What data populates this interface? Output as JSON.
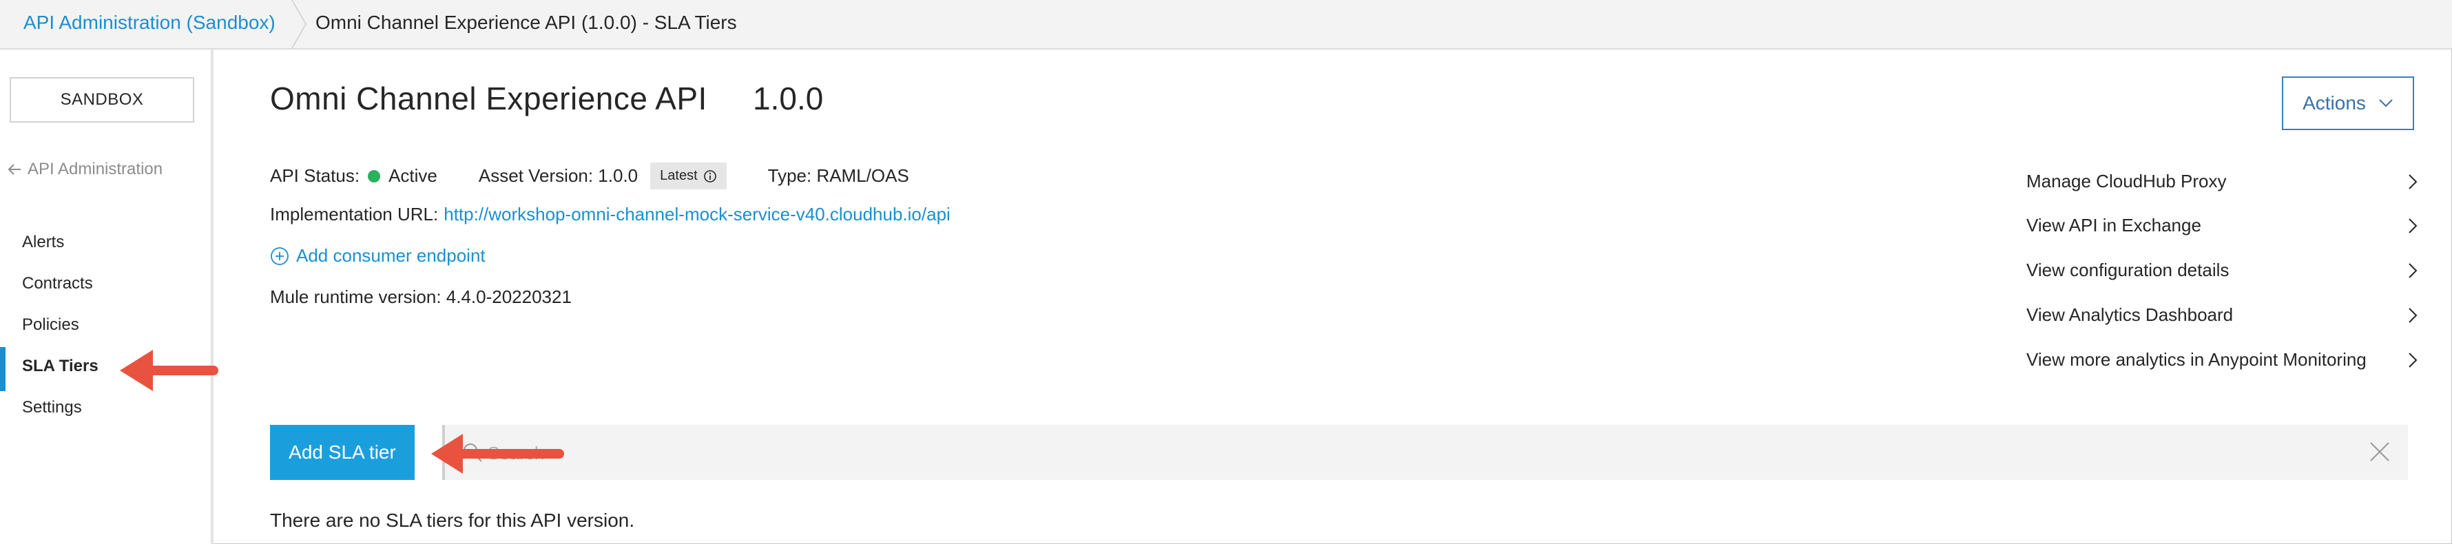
{
  "breadcrumb": {
    "parent": "API Administration (Sandbox)",
    "current": "Omni Channel Experience API (1.0.0) - SLA Tiers"
  },
  "sidebar": {
    "environment": "SANDBOX",
    "back_label": "API Administration",
    "items": [
      {
        "label": "Alerts"
      },
      {
        "label": "Contracts"
      },
      {
        "label": "Policies"
      },
      {
        "label": "SLA Tiers",
        "active": true
      },
      {
        "label": "Settings"
      }
    ]
  },
  "header": {
    "title": "Omni Channel Experience API",
    "version": "1.0.0",
    "actions_label": "Actions"
  },
  "details": {
    "status_label": "API Status:",
    "status_value": "Active",
    "asset_version_label": "Asset Version: 1.0.0",
    "latest_badge": "Latest",
    "type_label": "Type: RAML/OAS",
    "impl_url_label": "Implementation URL:",
    "impl_url": "http://workshop-omni-channel-mock-service-v40.cloudhub.io/api",
    "add_endpoint": "Add consumer endpoint",
    "runtime": "Mule runtime version: 4.4.0-20220321"
  },
  "side_links": [
    {
      "label": "Manage CloudHub Proxy"
    },
    {
      "label": "View API in Exchange"
    },
    {
      "label": "View configuration details"
    },
    {
      "label": "View Analytics Dashboard"
    },
    {
      "label": "View more analytics in Anypoint Monitoring"
    }
  ],
  "sla": {
    "add_button": "Add SLA tier",
    "search_placeholder": "Search",
    "empty_message": "There are no SLA tiers for this API version."
  },
  "colors": {
    "accent": "#1b9fdc",
    "link": "#1a8fd0",
    "status_active": "#2ab15d",
    "annotation_arrow": "#e8533f"
  }
}
